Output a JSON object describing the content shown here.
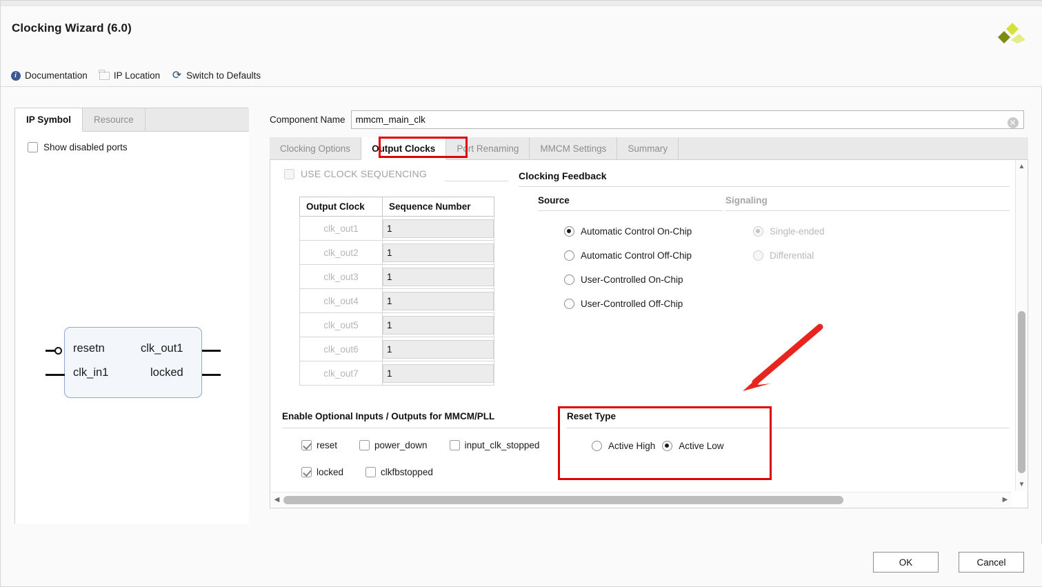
{
  "window": {
    "title": "Clocking Wizard (6.0)",
    "logo_name": "xilinx-logo"
  },
  "toolbar": {
    "documentation": "Documentation",
    "ip_location": "IP Location",
    "switch_defaults": "Switch to Defaults"
  },
  "left_panel": {
    "tabs": [
      {
        "label": "IP Symbol",
        "active": true
      },
      {
        "label": "Resource",
        "active": false
      }
    ],
    "show_disabled_ports": {
      "label": "Show disabled ports",
      "checked": false
    },
    "symbol": {
      "inputs": [
        "resetn",
        "clk_in1"
      ],
      "outputs": [
        "clk_out1",
        "locked"
      ]
    }
  },
  "component_name": {
    "label": "Component Name",
    "value": "mmcm_main_clk",
    "placeholder": "",
    "clear_icon": "clear-icon"
  },
  "tabs": [
    {
      "label": "Clocking Options",
      "active": false
    },
    {
      "label": "Output Clocks",
      "active": true
    },
    {
      "label": "Port Renaming",
      "active": false
    },
    {
      "label": "MMCM Settings",
      "active": false
    },
    {
      "label": "Summary",
      "active": false
    }
  ],
  "clock_sequencing": {
    "toggle_label": "USE CLOCK SEQUENCING",
    "toggle_checked": false,
    "toggle_disabled": true,
    "columns": [
      "Output Clock",
      "Sequence Number"
    ],
    "rows": [
      {
        "clock": "clk_out1",
        "sequence": "1"
      },
      {
        "clock": "clk_out2",
        "sequence": "1"
      },
      {
        "clock": "clk_out3",
        "sequence": "1"
      },
      {
        "clock": "clk_out4",
        "sequence": "1"
      },
      {
        "clock": "clk_out5",
        "sequence": "1"
      },
      {
        "clock": "clk_out6",
        "sequence": "1"
      },
      {
        "clock": "clk_out7",
        "sequence": "1"
      }
    ]
  },
  "clocking_feedback": {
    "title": "Clocking Feedback",
    "source": {
      "title": "Source",
      "options": [
        {
          "label": "Automatic Control On-Chip",
          "selected": true
        },
        {
          "label": "Automatic Control Off-Chip",
          "selected": false
        },
        {
          "label": "User-Controlled On-Chip",
          "selected": false
        },
        {
          "label": "User-Controlled Off-Chip",
          "selected": false
        }
      ]
    },
    "signaling": {
      "title": "Signaling",
      "disabled": true,
      "options": [
        {
          "label": "Single-ended",
          "selected": true
        },
        {
          "label": "Differential",
          "selected": false
        }
      ]
    }
  },
  "optional_io": {
    "title": "Enable Optional Inputs / Outputs for MMCM/PLL",
    "row1": [
      {
        "label": "reset",
        "checked": true
      },
      {
        "label": "power_down",
        "checked": false
      },
      {
        "label": "input_clk_stopped",
        "checked": false
      }
    ],
    "row2": [
      {
        "label": "locked",
        "checked": true
      },
      {
        "label": "clkfbstopped",
        "checked": false
      }
    ]
  },
  "reset_type": {
    "title": "Reset Type",
    "options": [
      {
        "label": "Active High",
        "selected": false
      },
      {
        "label": "Active Low",
        "selected": true
      }
    ]
  },
  "footer": {
    "ok": "OK",
    "cancel": "Cancel"
  },
  "annotations": {
    "highlight_color": "#e00000",
    "arrow_color": "#e8241f"
  }
}
